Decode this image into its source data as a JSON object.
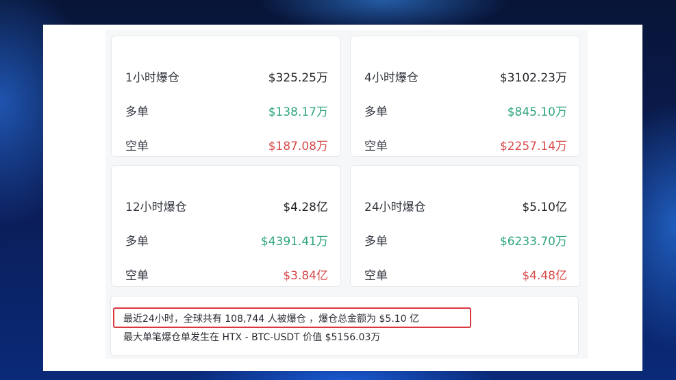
{
  "stats": [
    {
      "period": "1小时爆仓",
      "total": "$325.25万",
      "long_label": "多单",
      "long_value": "$138.17万",
      "short_label": "空单",
      "short_value": "$187.08万"
    },
    {
      "period": "4小时爆仓",
      "total": "$3102.23万",
      "long_label": "多单",
      "long_value": "$845.10万",
      "short_label": "空单",
      "short_value": "$2257.14万"
    },
    {
      "period": "12小时爆仓",
      "total": "$4.28亿",
      "long_label": "多单",
      "long_value": "$4391.41万",
      "short_label": "空单",
      "short_value": "$3.84亿"
    },
    {
      "period": "24小时爆仓",
      "total": "$5.10亿",
      "long_label": "多单",
      "long_value": "$6233.70万",
      "short_label": "空单",
      "short_value": "$4.48亿"
    }
  ],
  "summary": {
    "line1": "最近24小时，全球共有 108,744 人被爆仓 ，爆仓总金额为 $5.10 亿",
    "line2": "最大单笔爆仓单发生在 HTX - BTC-USDT 价值 $5156.03万"
  },
  "colors": {
    "long": "#2ea57d",
    "short": "#d74a4a",
    "highlight": "#d9363e"
  }
}
